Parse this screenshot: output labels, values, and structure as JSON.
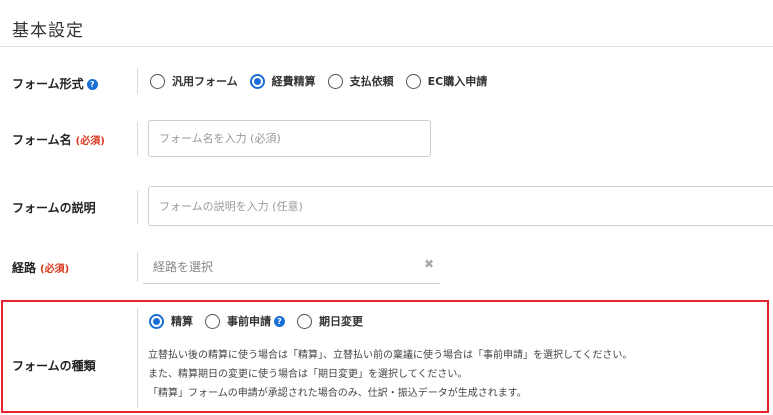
{
  "section": {
    "title": "基本設定"
  },
  "form_type": {
    "label": "フォーム形式",
    "options": [
      {
        "label": "汎用フォーム",
        "checked": false
      },
      {
        "label": "経費精算",
        "checked": true
      },
      {
        "label": "支払依頼",
        "checked": false
      },
      {
        "label": "EC購入申請",
        "checked": false
      }
    ]
  },
  "form_name": {
    "label": "フォーム名",
    "required": "(必須)",
    "placeholder": "フォーム名を入力 (必須)"
  },
  "form_desc": {
    "label": "フォームの説明",
    "placeholder": "フォームの説明を入力 (任意)"
  },
  "route": {
    "label": "経路",
    "required": "(必須)",
    "placeholder": "経路を選択",
    "clear_glyph": "✖"
  },
  "form_kind": {
    "label": "フォームの種類",
    "options": [
      {
        "label": "精算",
        "checked": true
      },
      {
        "label": "事前申請",
        "checked": false,
        "help": true
      },
      {
        "label": "期日変更",
        "checked": false
      }
    ],
    "description": [
      "立替払い後の精算に使う場合は「精算」、立替払い前の稟議に使う場合は「事前申請」を選択してください。",
      "また、精算期日の変更に使う場合は「期日変更」を選択してください。",
      "「精算」フォームの申請が承認された場合のみ、仕訳・振込データが生成されます。"
    ]
  },
  "colors": {
    "accent": "#1a6fd6",
    "required": "#d9381e",
    "highlight": "#e8212e"
  },
  "icons": {
    "help": "question-circle-icon",
    "clear": "clear-x-icon"
  }
}
